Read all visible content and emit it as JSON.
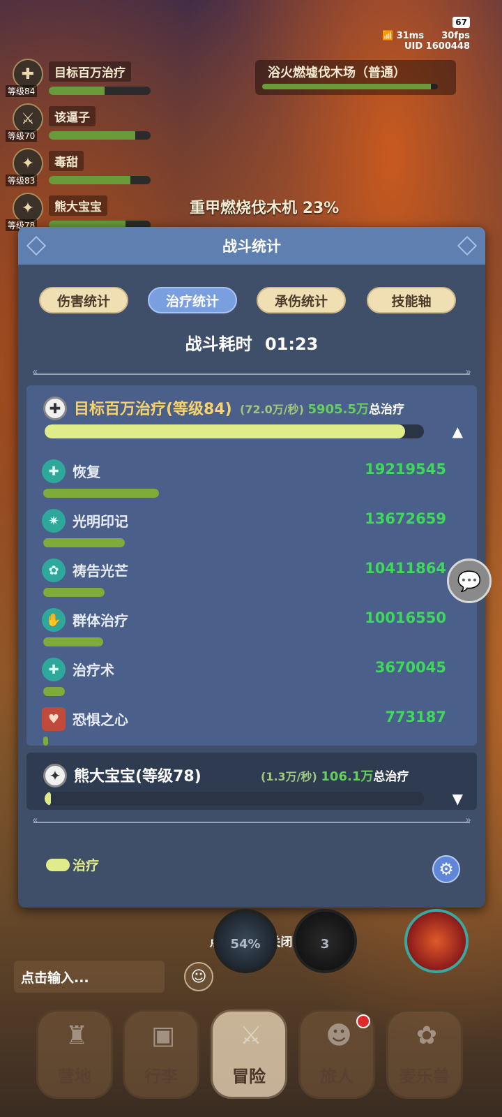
{
  "status": {
    "battery": "67",
    "ping": "31ms",
    "fps": "30fps",
    "uid": "UID  1600448"
  },
  "party": [
    {
      "name": "目标百万治疗",
      "level": "等级84",
      "icon": "cross",
      "hp": 0.55
    },
    {
      "name": "该逼子",
      "level": "等级70",
      "icon": "sword",
      "hp": 0.85
    },
    {
      "name": "毒甜",
      "level": "等级83",
      "icon": "claw",
      "hp": 0.8
    },
    {
      "name": "熊大宝宝",
      "level": "等级78",
      "icon": "claw",
      "hp": 0.75
    }
  ],
  "zone": {
    "name": "浴火燃墟伐木场（普通）",
    "progress": 0.96
  },
  "boss": {
    "name": "重甲燃烧伐木机",
    "percent": "23%"
  },
  "panel": {
    "title": "战斗统计",
    "tabs": [
      {
        "label": "伤害统计",
        "active": false
      },
      {
        "label": "治疗统计",
        "active": true
      },
      {
        "label": "承伤统计",
        "active": false
      },
      {
        "label": "技能轴",
        "active": false
      }
    ],
    "duration_label": "战斗耗时",
    "duration": "01:23",
    "players": [
      {
        "name": "目标百万治疗(等级84)",
        "rate": "(72.0万/秒)",
        "total": "5905.5万",
        "total_label": "总治疗",
        "bar": 0.95,
        "expanded": true,
        "skills": [
          {
            "name": "恢复",
            "value": "19219545",
            "ratio": 0.32,
            "icon": "heal"
          },
          {
            "name": "光明印记",
            "value": "13672659",
            "ratio": 0.225,
            "icon": "star"
          },
          {
            "name": "祷告光芒",
            "value": "10411864",
            "ratio": 0.17,
            "icon": "pray"
          },
          {
            "name": "群体治疗",
            "value": "10016550",
            "ratio": 0.165,
            "icon": "hands"
          },
          {
            "name": "治疗术",
            "value": "3670045",
            "ratio": 0.06,
            "icon": "heal"
          },
          {
            "name": "恐惧之心",
            "value": "773187",
            "ratio": 0.013,
            "icon": "heart"
          }
        ]
      },
      {
        "name": "熊大宝宝(等级78)",
        "rate": "(1.3万/秒)",
        "total": "106.1万",
        "total_label": "总治疗",
        "bar": 0.017,
        "expanded": false
      }
    ],
    "legend": "治疗"
  },
  "close_hint": "点击空白处关闭",
  "chat": {
    "placeholder": "点击输入..."
  },
  "slots": [
    {
      "label": "54%"
    },
    {
      "label": "3"
    },
    {
      "label": ""
    }
  ],
  "nav": [
    {
      "label": "营地",
      "active": false,
      "badge": false
    },
    {
      "label": "行李",
      "active": false,
      "badge": false
    },
    {
      "label": "冒险",
      "active": true,
      "badge": false
    },
    {
      "label": "旅人",
      "active": false,
      "badge": true
    },
    {
      "label": "麦乐兽",
      "active": false,
      "badge": false
    }
  ]
}
